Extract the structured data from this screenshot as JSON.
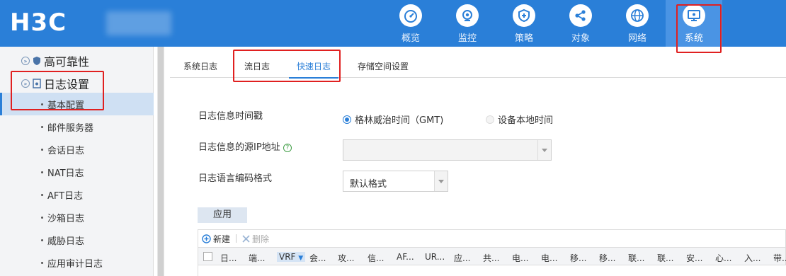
{
  "brand": {
    "logo_text": "H3C",
    "device_name": ""
  },
  "nav": {
    "items": [
      {
        "label": "概览",
        "icon": "gauge-icon"
      },
      {
        "label": "监控",
        "icon": "camera-icon"
      },
      {
        "label": "策略",
        "icon": "shield-icon"
      },
      {
        "label": "对象",
        "icon": "share-icon"
      },
      {
        "label": "网络",
        "icon": "globe-icon"
      },
      {
        "label": "系统",
        "icon": "monitor-gear-icon",
        "active": true
      }
    ]
  },
  "sidebar": {
    "groups": [
      {
        "label": "高可靠性",
        "expanded": false
      },
      {
        "label": "日志设置",
        "expanded": true
      }
    ],
    "items": [
      {
        "label": "基本配置",
        "active": true
      },
      {
        "label": "邮件服务器"
      },
      {
        "label": "会话日志"
      },
      {
        "label": "NAT日志"
      },
      {
        "label": "AFT日志"
      },
      {
        "label": "沙箱日志"
      },
      {
        "label": "威胁日志"
      },
      {
        "label": "应用审计日志"
      }
    ]
  },
  "tabs": [
    {
      "label": "系统日志"
    },
    {
      "label": "流日志"
    },
    {
      "label": "快速日志",
      "active": true
    },
    {
      "label": "存储空间设置"
    }
  ],
  "form": {
    "timestamp_label": "日志信息时间戳",
    "timestamp_options": [
      {
        "label": "格林威治时间（GMT)",
        "selected": true
      },
      {
        "label": "设备本地时间",
        "selected": false
      }
    ],
    "source_ip_label": "日志信息的源IP地址",
    "help_glyph": "?",
    "source_ip_value": "",
    "encoding_label": "日志语言编码格式",
    "encoding_value": "默认格式",
    "apply_label": "应用"
  },
  "toolbar": {
    "new_label": "新建",
    "delete_label": "删除"
  },
  "table": {
    "columns": [
      "日...",
      "端...",
      "VRF",
      "会...",
      "攻...",
      "信...",
      "AF...",
      "UR...",
      "应...",
      "共...",
      "电...",
      "电...",
      "移...",
      "移...",
      "联...",
      "联...",
      "安...",
      "心...",
      "入...",
      "带..."
    ]
  },
  "colors": {
    "topbar": "#2a7fd8",
    "accent": "#2a7fd8",
    "highlight": "#e02020"
  }
}
